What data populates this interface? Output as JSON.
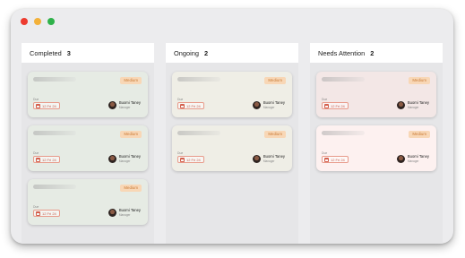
{
  "window": {
    "controls": [
      "close-dot",
      "minimize-dot",
      "maximize-dot"
    ]
  },
  "columns": [
    {
      "title": "Completed",
      "count": "3",
      "cards": [
        {
          "color": "green",
          "priority": "Medium",
          "due_label": "Due",
          "date": "12 Fri 24",
          "assignee": "Buomi Taney",
          "role": "Manager"
        },
        {
          "color": "green",
          "priority": "Medium",
          "due_label": "Due",
          "date": "12 Fri 24",
          "assignee": "Buomi Taney",
          "role": "Manager"
        },
        {
          "color": "green",
          "priority": "Medium",
          "due_label": "Due",
          "date": "12 Fri 24",
          "assignee": "Buomi Taney",
          "role": "Manager"
        }
      ]
    },
    {
      "title": "Ongoing",
      "count": "2",
      "cards": [
        {
          "color": "cream",
          "priority": "Medium",
          "due_label": "Due",
          "date": "12 Fri 24",
          "assignee": "Buomi Taney",
          "role": "Manager"
        },
        {
          "color": "cream",
          "priority": "Medium",
          "due_label": "Due",
          "date": "12 Fri 24",
          "assignee": "Buomi Taney",
          "role": "Manager"
        }
      ]
    },
    {
      "title": "Needs Attention",
      "count": "2",
      "cards": [
        {
          "color": "pink",
          "priority": "Medium",
          "due_label": "Due",
          "date": "12 Fri 24",
          "assignee": "Buomi Taney",
          "role": "Manager"
        },
        {
          "color": "lightpink",
          "priority": "Medium",
          "due_label": "Due",
          "date": "12 Fri 24",
          "assignee": "Buomi Taney",
          "role": "Manager"
        }
      ]
    }
  ]
}
